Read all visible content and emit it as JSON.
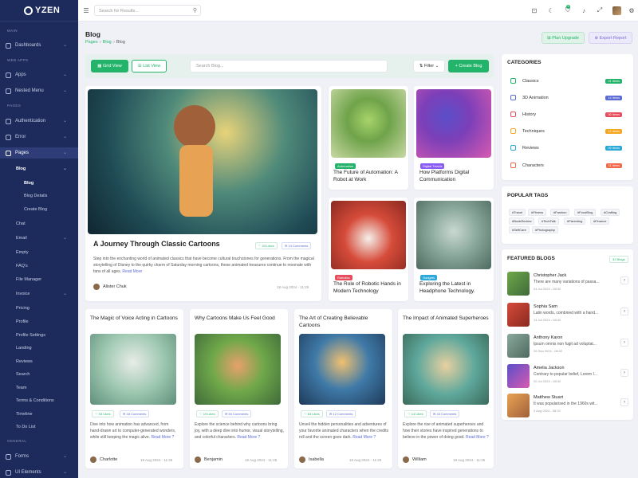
{
  "app": {
    "name": "YZEN"
  },
  "topbar": {
    "search_placeholder": "Search for Results...",
    "notif_count": "5"
  },
  "sidebar": {
    "sec_main": "MAIN",
    "sec_web": "WEB APPS",
    "sec_pages": "PAGES",
    "sec_general": "GENERAL",
    "items": [
      "Dashboards",
      "Apps",
      "Nested Menu",
      "Authentication",
      "Error",
      "Pages",
      "Blog",
      "Blog",
      "Blog Details",
      "Create Blog",
      "Chat",
      "Email",
      "Empty",
      "FAQ's",
      "File Manager",
      "Invoice",
      "Pricing",
      "Profile",
      "Profile Settings",
      "Landing",
      "Reviews",
      "Search",
      "Team",
      "Terms & Conditions",
      "Timeline",
      "To Do List",
      "Forms",
      "UI Elements"
    ]
  },
  "page": {
    "title": "Blog",
    "crumb1": "Pages",
    "crumb2": "Blog",
    "crumb3": "Blog",
    "plan_upgrade": "Plan Upgrade",
    "export_report": "Export Report"
  },
  "toolbar": {
    "grid_view": "Grid View",
    "list_view": "List View",
    "search_placeholder": "Search Blog...",
    "filter": "Filter",
    "create_blog": "Create Blog"
  },
  "featured_main": {
    "title": "A Journey Through Classic Cartoons",
    "likes": "03 Likes",
    "comments": "14 Comments",
    "desc": "Step into the enchanting world of animated classics that have become cultural touchstones for generations. From the magical storytelling of Disney to the quirky charm of Saturday morning cartoons, these animated treasures continue to resonate with fans of all ages.",
    "read_more": "Read More",
    "author": "Alister Chuk",
    "date": "18 Aug 2024 - 11:25"
  },
  "small_posts": [
    {
      "tag": "Automation",
      "title": "The Future of Automation: A Robot at Work",
      "tag_color": "#23b36a"
    },
    {
      "tag": "Digital Trends",
      "title": "How Platforms Digital Communication",
      "tag_color": "#8a5cf6"
    },
    {
      "tag": "Robotics",
      "title": "The Role of Robotic Hands in Modern Technology",
      "tag_color": "#e74c5c"
    },
    {
      "tag": "Gadgets",
      "title": "Exploring the Latest in Headphone Technology.",
      "tag_color": "#2aa8d8"
    }
  ],
  "bottom_posts": [
    {
      "title": "The Magic of Voice Acting in Cartoons",
      "likes": "03 Likes",
      "comments": "18 Comments",
      "desc": "Dive into how animation has advanced, from hand-drawn art to computer-generated wonders, while still keeping the magic alive.",
      "read_more": "Read More ?",
      "author": "Charlotte",
      "date": "18 Aug 2024 - 11:25"
    },
    {
      "title": "Why Cartoons Make Us Feel Good",
      "likes": "19 Likes",
      "comments": "54 Comments",
      "desc": "Explore the science behind why cartoons bring joy, with a deep dive into humor, visual storytelling, and colorful characters.",
      "read_more": "Read More ?",
      "author": "Benjamin",
      "date": "18 Aug 2024 - 11:25"
    },
    {
      "title": "The Art of Creating Believable Cartoons",
      "likes": "53 Likes",
      "comments": "12 Comments",
      "desc": "Unveil the hidden personalities and adventures of your favorite animated characters when the credits roll and the screen goes dark.",
      "read_more": "Read More ?",
      "author": "Isabella",
      "date": "18 Aug 2024 - 11:25"
    },
    {
      "title": "The Impact of Animated Superheroes",
      "likes": "14 Likes",
      "comments": "43 Comments",
      "desc": "Explore the rise of animated superheroes and how their stories have inspired generations to believe in the power of doing good.",
      "read_more": "Read More ?",
      "author": "William",
      "date": "18 Aug 2024 - 11:25"
    }
  ],
  "categories": {
    "title": "CATEGORIES",
    "items": [
      {
        "name": "Classics",
        "count": "21 Items",
        "color": "#23b36a"
      },
      {
        "name": "3D Animation",
        "count": "14 Items",
        "color": "#5a6bd6"
      },
      {
        "name": "History",
        "count": "06 Items",
        "color": "#e74c5c"
      },
      {
        "name": "Techniques",
        "count": "12 Items",
        "color": "#f5a623"
      },
      {
        "name": "Reviews",
        "count": "09 Items",
        "color": "#2aa8d8"
      },
      {
        "name": "Characters",
        "count": "11 Items",
        "color": "#f06a4a"
      }
    ]
  },
  "popular_tags": {
    "title": "POPULAR TAGS",
    "tags": [
      "#Travel",
      "#Fitness",
      "#Fashion",
      "#FoodBlog",
      "#Crafting",
      "#BookReview",
      "#TechTalk",
      "#Parenting",
      "#Finance",
      "#SelfCare",
      "#Photography"
    ]
  },
  "featured_blogs": {
    "title": "FEATURED BLOGS",
    "count": "32 Blogs",
    "items": [
      {
        "name": "Christopher Jack",
        "text": "There are many variations of passa...",
        "date": "24 Jul 2024 - 08:32"
      },
      {
        "name": "Sophia Sam",
        "text": "Latin words, combined with a hand...",
        "date": "14 Jul 2024 - 08:32"
      },
      {
        "name": "Anthony Karon",
        "text": "Ipsum omnis non fugit ad voluptat...",
        "date": "26 Sep 2024 - 08:32"
      },
      {
        "name": "Amelia Jackson",
        "text": "Contrary to popular belief, Lorem I...",
        "date": "20 Jul 2024 - 08:32"
      },
      {
        "name": "Matthew Stuart",
        "text": "It was popularised in the 1960s wit...",
        "date": "3 Aug 2024 - 08:32"
      }
    ]
  }
}
